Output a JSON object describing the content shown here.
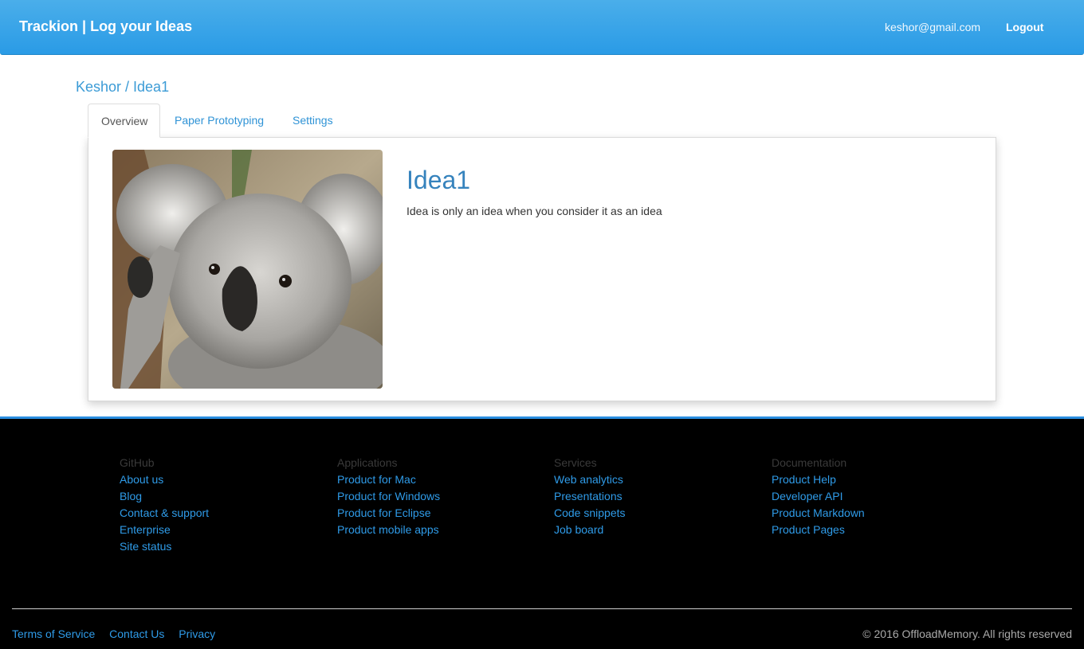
{
  "navbar": {
    "brand": "Trackion | Log your Ideas",
    "email": "keshor@gmail.com",
    "logout": "Logout"
  },
  "breadcrumb": "Keshor / Idea1",
  "tabs": [
    {
      "label": "Overview",
      "active": true
    },
    {
      "label": "Paper Prototyping",
      "active": false
    },
    {
      "label": "Settings",
      "active": false
    }
  ],
  "idea": {
    "title": "Idea1",
    "description": "Idea is only an idea when you consider it as an idea",
    "image": "koala-photo"
  },
  "footer": {
    "columns": [
      {
        "heading": "GitHub",
        "links": [
          "About us",
          "Blog",
          "Contact & support",
          "Enterprise",
          "Site status"
        ]
      },
      {
        "heading": "Applications",
        "links": [
          "Product for Mac",
          "Product for Windows",
          "Product for Eclipse",
          "Product mobile apps"
        ]
      },
      {
        "heading": "Services",
        "links": [
          "Web analytics",
          "Presentations",
          "Code snippets",
          "Job board"
        ]
      },
      {
        "heading": "Documentation",
        "links": [
          "Product Help",
          "Developer API",
          "Product Markdown",
          "Product Pages"
        ]
      }
    ],
    "bottom_links": [
      "Terms of Service",
      "Contact Us",
      "Privacy"
    ],
    "copyright": "© 2016 OffloadMemory. All rights reserved"
  },
  "colors": {
    "navbar": "#2a9be6",
    "link": "#2f9be8",
    "title": "#3683bd",
    "footer_bg": "#000000",
    "footer_border": "#2a8ee0"
  }
}
